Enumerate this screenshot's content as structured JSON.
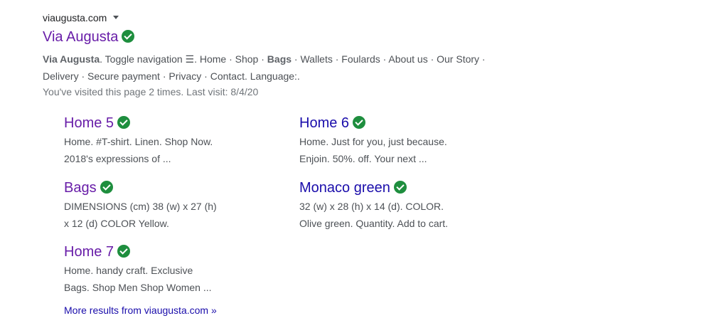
{
  "result": {
    "cite": "viaugusta.com",
    "title": "Via Augusta",
    "snippet_bold_1": "Via Augusta",
    "snippet_part_1": ". Toggle navigation ☰. Home · Shop · ",
    "snippet_bold_2": "Bags",
    "snippet_part_2": " · Wallets · Foulards · About us · Our Story · Delivery · Secure payment · Privacy · Contact. Language:.",
    "visited_note": "You've visited this page 2 times. Last visit: 8/4/20"
  },
  "sitelinks": [
    {
      "title": "Home 5",
      "desc_1": "Home. #T-shirt. Linen. Shop Now.",
      "desc_2": "2018's expressions of ..."
    },
    {
      "title": "Home 6",
      "desc_1": "Home. Just for you, just because.",
      "desc_2": "Enjoin. 50%. off. Your next ..."
    },
    {
      "title": "Bags",
      "desc_1": "DIMENSIONS (cm) 38 (w) x 27 (h)",
      "desc_2": "x 12 (d) COLOR Yellow."
    },
    {
      "title": "Monaco green",
      "desc_1": "32 (w) x 28 (h) x 14 (d). COLOR.",
      "desc_2": "Olive green. Quantity. Add to cart."
    },
    {
      "title": "Home 7",
      "desc_1": "Home. handy craft. Exclusive",
      "desc_2": "Bags. Shop Men Shop Women ..."
    }
  ],
  "more_results": "More results from viaugusta.com »",
  "colors": {
    "visited_link": "#681da8",
    "link": "#1a0dab",
    "verified_badge": "#1e8e3e"
  },
  "icons": {
    "verified": "verified-check-icon",
    "menu_caret": "caret-down-icon"
  }
}
